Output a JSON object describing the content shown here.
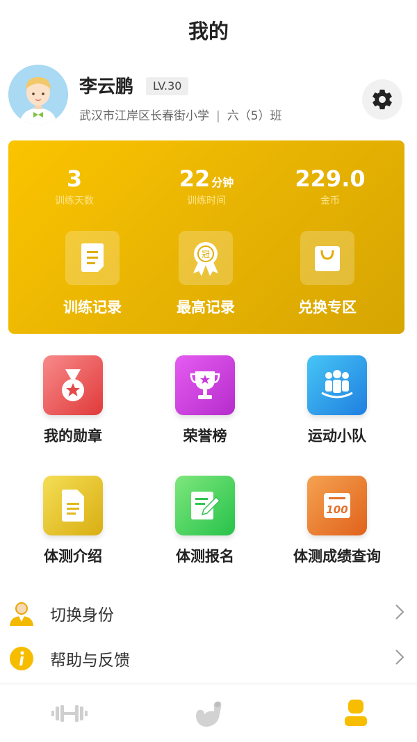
{
  "header": {
    "title": "我的"
  },
  "profile": {
    "name": "李云鹏",
    "level": "LV.30",
    "school": "武汉市江岸区长春街小学",
    "separator": "|",
    "class": "六（5）班"
  },
  "stats": [
    {
      "value": "3",
      "unit": "",
      "label": "训练天数"
    },
    {
      "value": "22",
      "unit": "分钟",
      "label": "训练时间"
    },
    {
      "value": "229.0",
      "unit": "",
      "label": "金币"
    }
  ],
  "card_actions": [
    {
      "label": "训练记录",
      "icon": "document-icon"
    },
    {
      "label": "最高记录",
      "icon": "award-ribbon-icon"
    },
    {
      "label": "兑换专区",
      "icon": "shopping-bag-icon"
    }
  ],
  "grid": [
    {
      "label": "我的勋章",
      "icon": "medal-icon",
      "color": "#e84a4a"
    },
    {
      "label": "荣誉榜",
      "icon": "trophy-icon",
      "color": "#c839dc"
    },
    {
      "label": "运动小队",
      "icon": "team-icon",
      "color": "#2d93e6"
    },
    {
      "label": "体测介绍",
      "icon": "doc-icon",
      "color": "#e6c21d"
    },
    {
      "label": "体测报名",
      "icon": "edit-form-icon",
      "color": "#3fcf59"
    },
    {
      "label": "体测成绩查询",
      "icon": "score-100-icon",
      "color": "#ea7424"
    }
  ],
  "menu": [
    {
      "label": "切换身份",
      "icon": "person-icon"
    },
    {
      "label": "帮助与反馈",
      "icon": "info-icon"
    }
  ],
  "tabbar": [
    {
      "name": "training",
      "icon": "dumbbell-icon",
      "active": false
    },
    {
      "name": "exercise",
      "icon": "muscle-arm-icon",
      "active": false
    },
    {
      "name": "mine",
      "icon": "user-icon",
      "active": true
    }
  ],
  "colors": {
    "accent": "#f5bd02",
    "tab_active": "#f7bd00",
    "tab_inactive": "#cfcfcf"
  }
}
